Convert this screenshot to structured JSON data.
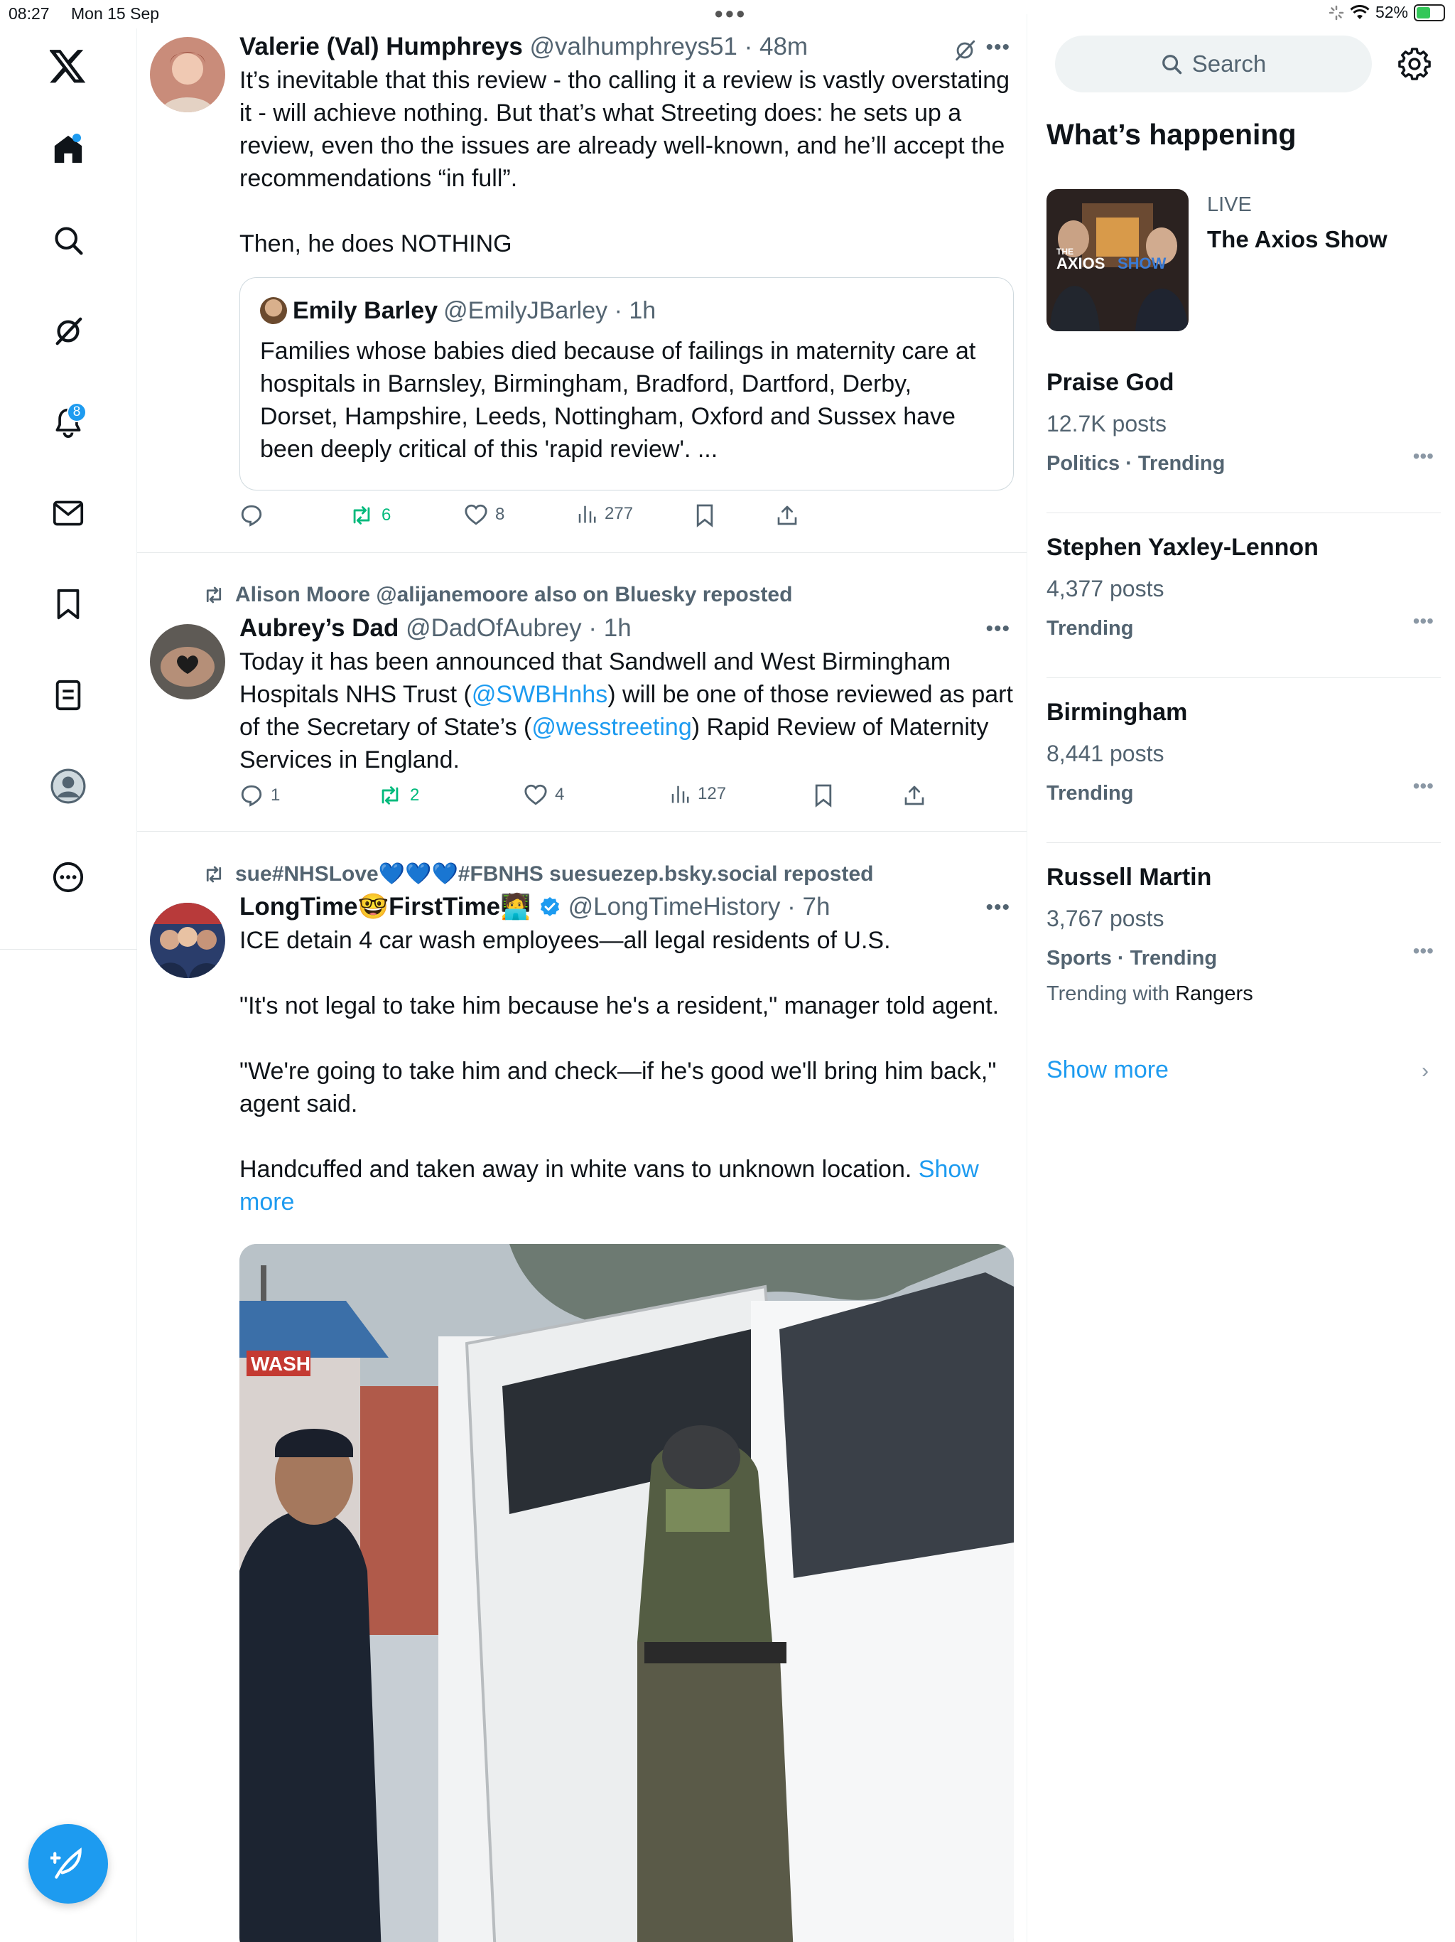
{
  "status": {
    "time": "08:27",
    "date": "Mon 15 Sep",
    "battery": "52%",
    "battery_level": 0.52
  },
  "nav": {
    "notifications_badge": "8",
    "icons": [
      "x-logo-icon",
      "home-icon",
      "search-icon",
      "grok-icon",
      "notifications-icon",
      "messages-icon",
      "bookmarks-icon",
      "lists-icon",
      "profile-icon",
      "more-icon"
    ]
  },
  "tweets": [
    {
      "name": "Valerie (Val) Humphreys",
      "handle": "@valhumphreys51 · 48m",
      "paragraphs": [
        "It’s inevitable that this review - tho calling it a review is vastly overstating it - will achieve nothing. But that’s what Streeting does: he sets up a review, even tho the issues are already well-known, and he’ll accept the recommendations “in full”.",
        "Then, he does NOTHING"
      ],
      "quote": {
        "name": "Emily Barley",
        "handle": "@EmilyJBarley · 1h",
        "text": "Families whose babies died because of failings in maternity care at hospitals in Barnsley, Birmingham, Bradford, Dartford, Derby, Dorset, Hampshire, Leeds, Nottingham, Oxford and Sussex have been deeply critical of this 'rapid review'. ..."
      },
      "actions": {
        "reply": "",
        "repost": "6",
        "like": "8",
        "views": "277"
      }
    },
    {
      "reposted_by": "Alison Moore @alijanemoore also on Bluesky reposted",
      "name": "Aubrey’s Dad",
      "handle": "@DadOfAubrey · 1h",
      "text_parts": {
        "t1": "Today it has been announced that Sandwell and West Birmingham Hospitals NHS Trust (",
        "l1": "@SWBHnhs",
        "t2": ") will be one of those reviewed as part of the Secretary of State’s (",
        "l2": "@wesstreeting",
        "t3": ") Rapid Review of Maternity Services in England."
      },
      "actions": {
        "reply": "1",
        "repost": "2",
        "like": "4",
        "views": "127"
      }
    },
    {
      "reposted_by": "sue#NHSLove💙💙💙#FBNHS suesuezep.bsky.social reposted",
      "name": "LongTime🤓FirstTime🧑‍💻",
      "handle": "@LongTimeHistory · 7h",
      "paragraphs": [
        "ICE detain 4 car wash employees—all legal residents of U.S.",
        "\"It's not legal to take him because he's a resident,\" manager told agent.",
        "\"We're going to take him and check—if he's good we'll bring him back,\" agent said."
      ],
      "last_paragraph": "Handcuffed and taken away in white vans to unknown location.",
      "show_more": "Show more",
      "media_sign": "WASH"
    }
  ],
  "sidebar": {
    "search_placeholder": "Search",
    "whats_happening": "What’s happening",
    "live": {
      "label": "LIVE",
      "title": "The Axios Show",
      "thumb_text_1": "THE",
      "thumb_text_2": "AXIOS",
      "thumb_text_3": "SHOW"
    },
    "trends": [
      {
        "title": "Praise God",
        "count": "12.7K posts",
        "category": "Politics · Trending"
      },
      {
        "title": "Stephen Yaxley-Lennon",
        "count": "4,377 posts",
        "category": "Trending"
      },
      {
        "title": "Birmingham",
        "count": "8,441 posts",
        "category": "Trending"
      },
      {
        "title": "Russell Martin",
        "count": "3,767 posts",
        "category": "Sports · Trending",
        "with_prefix": "Trending with",
        "with_name": "Rangers"
      }
    ],
    "show_more": "Show more"
  }
}
